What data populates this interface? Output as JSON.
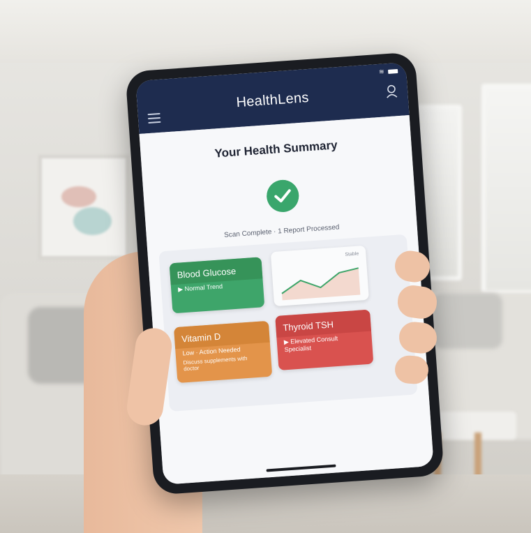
{
  "app": {
    "title": "HealthLens"
  },
  "summary": {
    "title": "Your Health Summary",
    "scan_status": "Scan Complete · 1 Report Processed"
  },
  "cards": {
    "blood_glucose": {
      "title": "Blood Glucose",
      "status": "Normal Trend",
      "color": "#3ea56a"
    },
    "trend_chart": {
      "label": "Stable",
      "values": [
        0.2,
        0.55,
        0.3,
        0.7,
        0.8
      ]
    },
    "vitamin_d": {
      "title": "Vitamin D",
      "status": "Low · Action Needed",
      "note": "Discuss supplements with doctor",
      "color": "#e3944a"
    },
    "thyroid": {
      "title": "Thyroid TSH",
      "status": "Elevated Consult Specialist",
      "color": "#d9524f"
    }
  },
  "icons": {
    "menu": "hamburger-menu-icon",
    "user": "user-icon",
    "check": "check-icon",
    "play": "play-triangle-icon"
  }
}
